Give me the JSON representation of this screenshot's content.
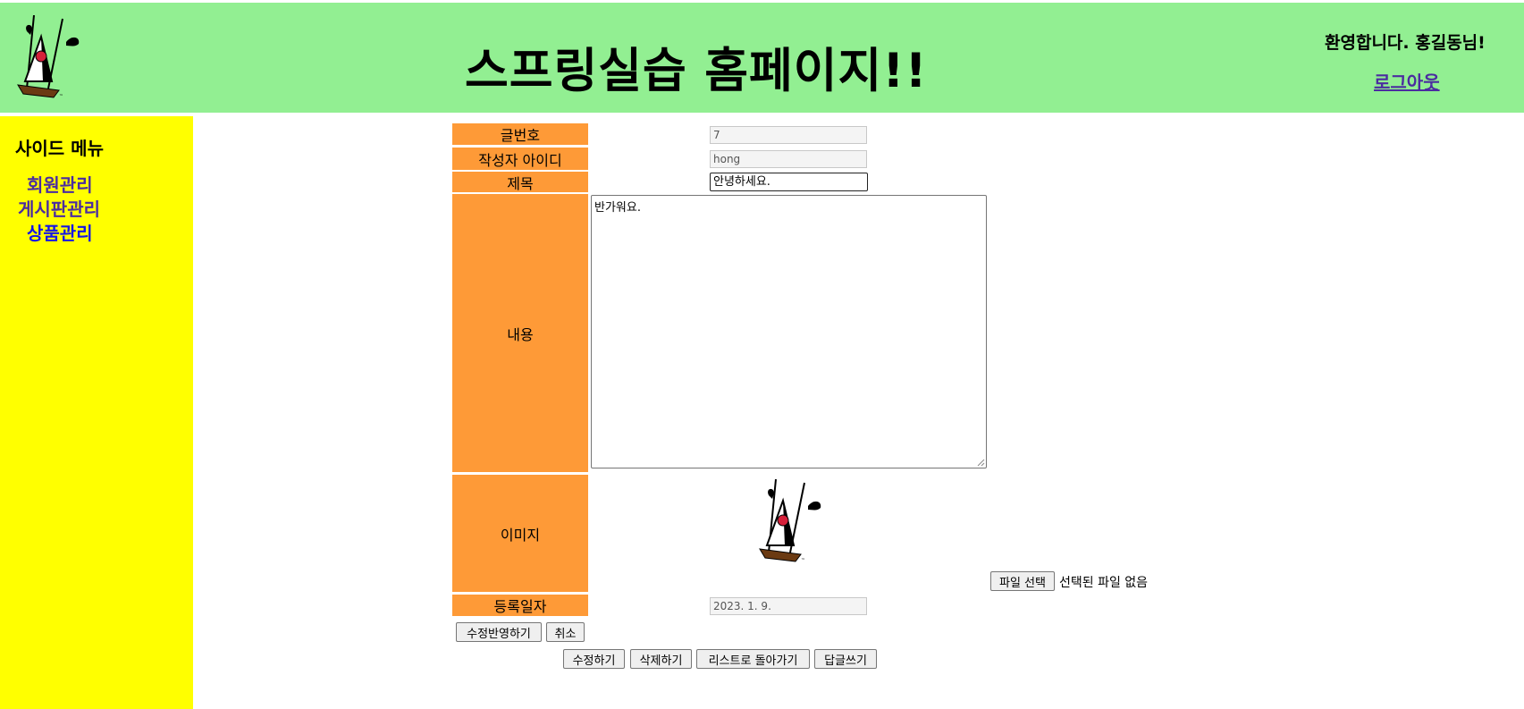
{
  "header": {
    "title": "스프링실습 홈페이지!!",
    "welcome": "환영합니다. 홍길동님!",
    "logout": "로그아웃"
  },
  "sidebar": {
    "title": "사이드 메뉴",
    "items": [
      {
        "label": "회원관리"
      },
      {
        "label": "게시판관리"
      },
      {
        "label": "상품관리"
      }
    ]
  },
  "form": {
    "labels": {
      "article_no": "글번호",
      "writer_id": "작성자 아이디",
      "title": "제목",
      "content": "내용",
      "image": "이미지",
      "reg_date": "등록일자"
    },
    "values": {
      "article_no": "7",
      "writer_id": "hong",
      "title": "안녕하세요.",
      "content": "반가워요.",
      "reg_date": "2023. 1. 9."
    },
    "file_button": "파일 선택",
    "file_status": "선택된 파일 없음"
  },
  "buttons": {
    "apply_edit": "수정반영하기",
    "cancel": "취소",
    "edit": "수정하기",
    "delete": "삭제하기",
    "back_to_list": "리스트로 돌아가기",
    "reply": "답글쓰기"
  },
  "colors": {
    "header_bg": "#92ef92",
    "sidebar_bg": "#ffff00",
    "label_bg": "#fe9a37",
    "link_visited": "#4b2ca0",
    "link": "#1515e6"
  }
}
